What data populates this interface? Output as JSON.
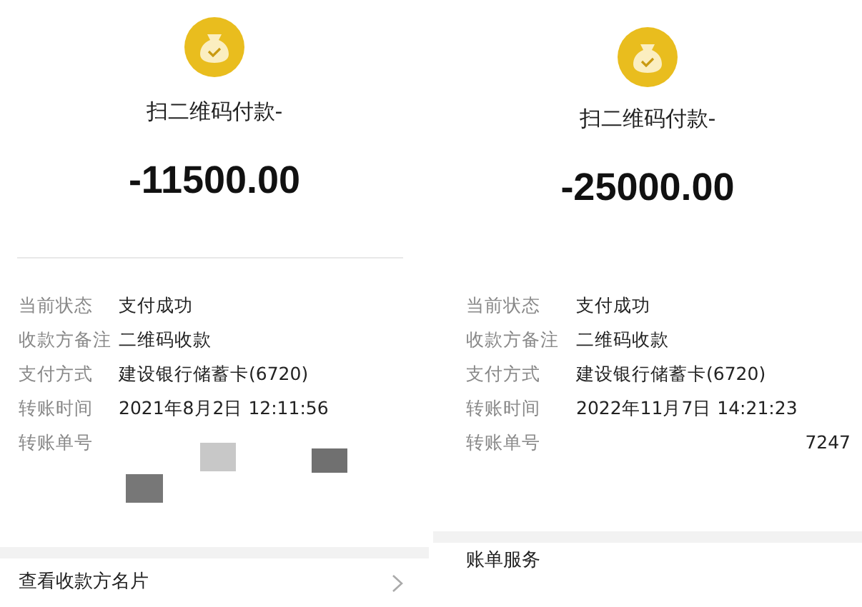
{
  "panels": [
    {
      "title": "扫二维码付款-",
      "amount": "-11500.00",
      "divider": true,
      "details": [
        {
          "label": "当前状态",
          "value": "支付成功"
        },
        {
          "label": "收款方备注",
          "value": "二维码收款"
        },
        {
          "label": "支付方式",
          "value": "建设银行储蓄卡(6720)"
        },
        {
          "label": "转账时间",
          "value": "2021年8月2日 12:11:56"
        },
        {
          "label": "转账单号",
          "redacted": true
        }
      ],
      "footer": {
        "label": "查看收款方名片",
        "chevron": true
      }
    },
    {
      "title": "扫二维码付款-",
      "amount": "-25000.00",
      "divider": false,
      "details": [
        {
          "label": "当前状态",
          "value": "支付成功"
        },
        {
          "label": "收款方备注",
          "value": "二维码收款"
        },
        {
          "label": "支付方式",
          "value": "建设银行储蓄卡(6720)"
        },
        {
          "label": "转账时间",
          "value": "2022年11月7日 14:21:23"
        },
        {
          "label": "转账单号",
          "value": "7247",
          "redacted": true
        }
      ],
      "footer": {
        "label": "账单服务",
        "chevron": false
      }
    }
  ]
}
